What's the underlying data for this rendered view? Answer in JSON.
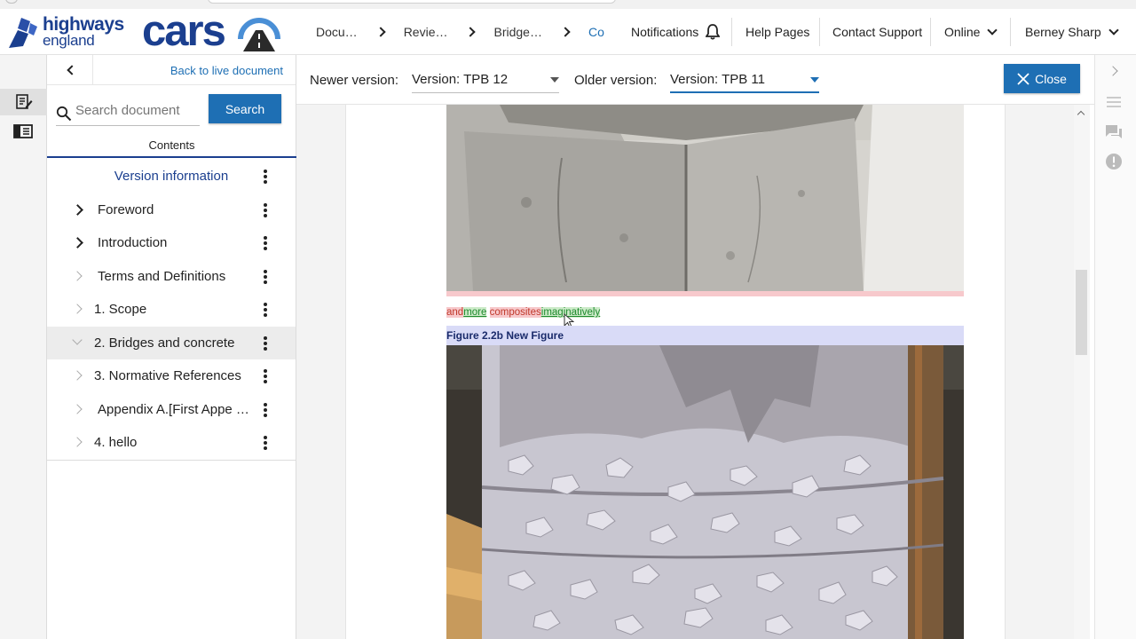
{
  "header": {
    "org_logo_line1": "highways",
    "org_logo_line2": "england",
    "app_logo": "cars",
    "breadcrumbs": [
      "Docu…",
      "Revie…",
      "Bridge…",
      "Co"
    ],
    "notifications_label": "Notifications",
    "help_label": "Help Pages",
    "support_label": "Contact Support",
    "status_label": "Online",
    "user_name": "Berney Sharp"
  },
  "panel": {
    "back_label": "Back to live document",
    "search_placeholder": "Search document",
    "search_button": "Search",
    "contents_tab": "Contents",
    "items": [
      {
        "label": "Version information",
        "expander": "none"
      },
      {
        "label": "Foreword",
        "expander": "dark"
      },
      {
        "label": "Introduction",
        "expander": "dark"
      },
      {
        "label": "Terms and Definitions",
        "expander": "light"
      },
      {
        "label": "1. Scope",
        "expander": "light"
      },
      {
        "label": "2. Bridges and concrete",
        "expander": "expanded"
      },
      {
        "label": "3. Normative References",
        "expander": "light"
      },
      {
        "label": "Appendix A.[First Appe …",
        "expander": "light"
      },
      {
        "label": "4. hello",
        "expander": "light"
      }
    ]
  },
  "compare": {
    "newer_label": "Newer version:",
    "newer_value": "Version: TPB 12",
    "older_label": "Older version:",
    "older_value": "Version: TPB 11",
    "close_label": "Close"
  },
  "document": {
    "diff_del_1": "and",
    "diff_ins_1": "more",
    "diff_space": " ",
    "diff_del_2": "composites",
    "diff_ins_2": "imaginatively",
    "figure_caption": "Figure 2.2b   New Figure"
  },
  "colors": {
    "brand_blue": "#1b3f8f",
    "action_blue": "#1e6fb4",
    "deleted_bg": "#f7c9cc",
    "inserted_bg": "#cdebc9",
    "caption_bg": "#d9dbf7"
  }
}
